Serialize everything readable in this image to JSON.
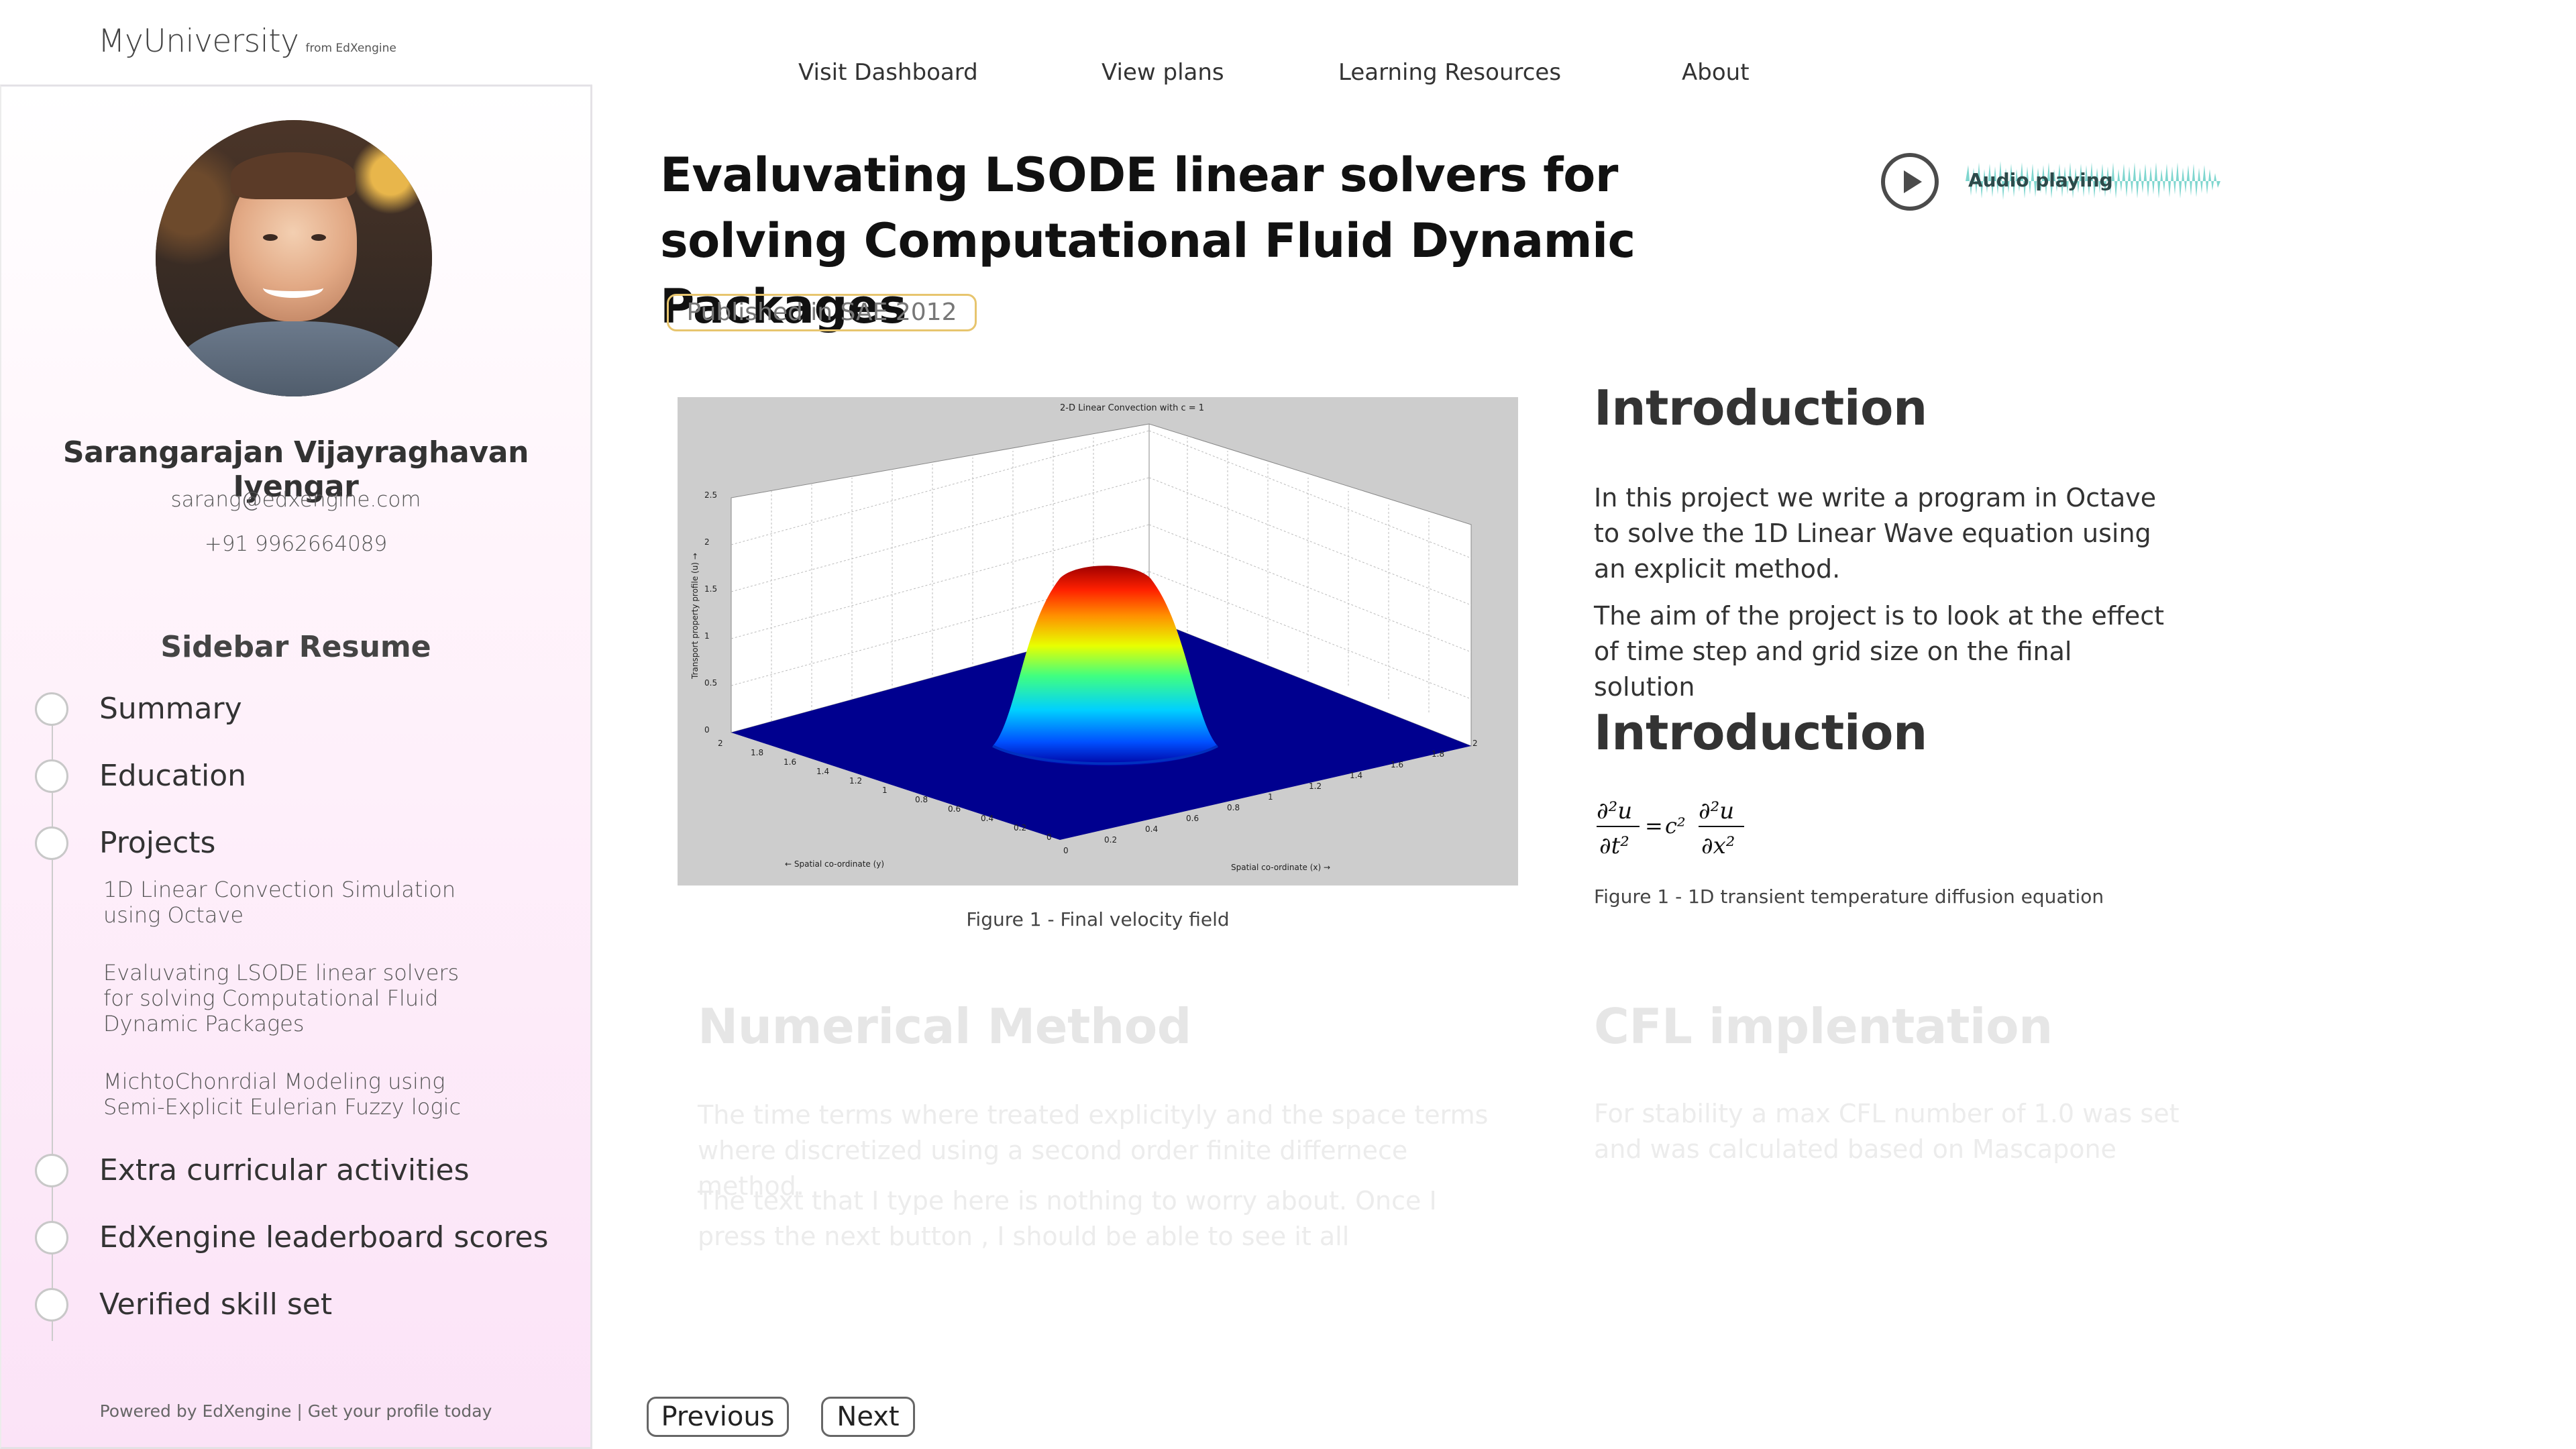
{
  "brand": {
    "name": "MyUniversity",
    "from": "from EdXengine"
  },
  "nav": {
    "dashboard": "Visit Dashboard",
    "plans": "View plans",
    "resources": "Learning Resources",
    "about": "About"
  },
  "profile": {
    "name": "Sarangarajan Vijayraghavan Iyengar",
    "email": "sarang@edxengine.com",
    "phone": "+91 9962664089"
  },
  "sidebar": {
    "title": "Sidebar Resume",
    "items": {
      "summary": "Summary",
      "education": "Education",
      "projects": "Projects",
      "extra": "Extra curricular activities",
      "leaderboard": "EdXengine leaderboard scores",
      "skills": "Verified skill set"
    },
    "projects": [
      "1D Linear Convection Simulation using Octave",
      "Evaluvating LSODE linear solvers for solving Computational Fluid Dynamic Packages",
      "MichtoChonrdial Modeling using Semi-Explicit Eulerian Fuzzy logic"
    ],
    "footer": "Powered by EdXengine | Get your profile today"
  },
  "page": {
    "title": "Evaluvating LSODE linear solvers for solving Computational Fluid Dynamic Packages",
    "badge": "Published in SAE 2012",
    "audio_label": "Audio playing"
  },
  "figure": {
    "plot_title": "2-D Linear Convection with c = 1",
    "z_axis_label": "Transport property profile (u) →",
    "x_axis_label": "Spatial co-ordinate (x) →",
    "y_axis_label": "← Spatial co-ordinate (y)",
    "caption": "Figure 1 - Final velocity field",
    "z_ticks": [
      "2.5",
      "2",
      "1.5",
      "1",
      "0.5",
      "0"
    ],
    "left_ticks": [
      "2",
      "1.8",
      "1.6",
      "1.4",
      "1.2",
      "1",
      "0.8",
      "0.6",
      "0.4",
      "0.2",
      "0"
    ],
    "right_ticks": [
      "0",
      "0.2",
      "0.4",
      "0.6",
      "0.8",
      "1",
      "1.2",
      "1.4",
      "1.6",
      "1.8",
      "2"
    ]
  },
  "intro": {
    "title": "Introduction",
    "para1": "In this project we write a program in Octave to solve the 1D Linear Wave equation using an explicit method.",
    "para2": "The aim of the project is to look at the effect of time step and grid size on the final solution"
  },
  "intro2": {
    "title": "Introduction",
    "eq_caption": "Figure 1 - 1D transient temperature diffusion equation"
  },
  "numerical": {
    "title": "Numerical Method",
    "para1": "The time terms where treated explicityly and the space terms where discretized using a second order finite differnece method.",
    "para2": "The text that I type here is nothing to worry about. Once I press the next button , I should be able to see it all"
  },
  "cfl": {
    "title": "CFL implentation",
    "para1": "For stability a max CFL number of 1.0 was set and was calculated based on Mascapone"
  },
  "pager": {
    "previous": "Previous",
    "next": "Next"
  },
  "colors": {
    "badge_border": "#e7c56e",
    "audio_wave": "#7fd6cf",
    "sidebar_bottom": "#fbe3f7"
  }
}
